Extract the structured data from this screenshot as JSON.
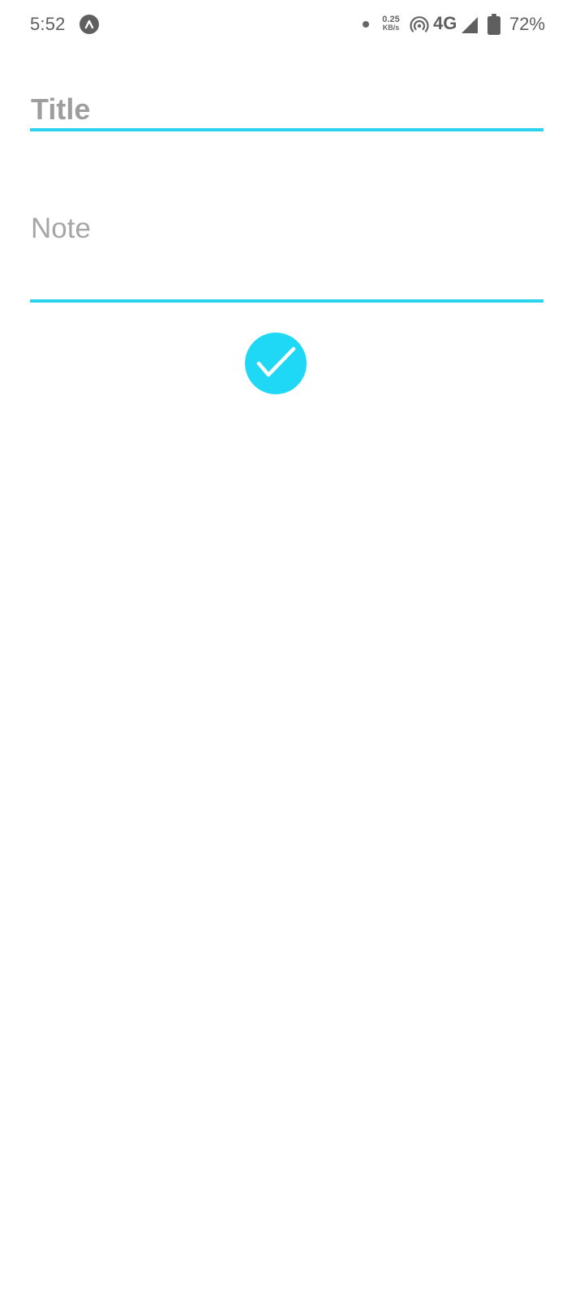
{
  "status_bar": {
    "time": "5:52",
    "app_icon": "caret-up-icon",
    "notification_dot": "dot-icon",
    "net_speed_value": "0.25",
    "net_speed_unit": "KB/s",
    "hotspot_icon": "hotspot-icon",
    "network_type": "4G",
    "signal_icon": "signal-icon",
    "battery_icon": "battery-icon",
    "battery_percent": "72%"
  },
  "form": {
    "title_placeholder": "Title",
    "note_placeholder": "Note",
    "save_icon": "checkmark-icon"
  },
  "colors": {
    "accent": "#2bd3ef",
    "fab": "#1fd8f6",
    "placeholder": "#9e9e9e"
  }
}
